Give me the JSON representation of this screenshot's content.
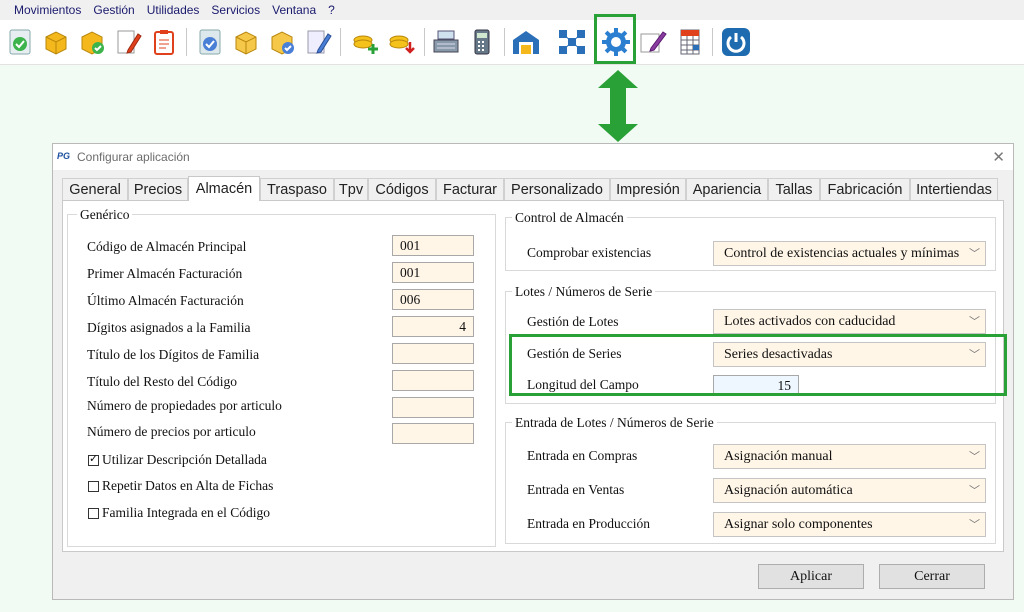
{
  "menu": [
    "Movimientos",
    "Gestión",
    "Utilidades",
    "Servicios",
    "Ventana",
    "?"
  ],
  "toolbar_icons": [
    "check-sphere-icon",
    "box-icon",
    "box-check-icon",
    "pencil-edit-icon",
    "clipboard-icon",
    "check-sphere-icon",
    "box-icon",
    "box-check-icon",
    "pencil-edit-icon",
    "coins-add-icon",
    "coins-download-icon",
    "cash-register-icon",
    "calculator-icon",
    "warehouse-icon",
    "network-icon",
    "gear-icon",
    "edit-pen-icon",
    "spreadsheet-icon",
    "power-icon"
  ],
  "colors": {
    "highlight": "#2aa137",
    "field_bg": "#fff6e8",
    "length_bg": "#eef6ff"
  },
  "dialog": {
    "logo": "PG",
    "title": "Configurar aplicación",
    "tabs": [
      "General",
      "Precios",
      "Almacén",
      "Traspaso",
      "Tpv",
      "Códigos",
      "Facturar",
      "Personalizado",
      "Impresión",
      "Apariencia",
      "Tallas",
      "Fabricación",
      "Intertiendas"
    ],
    "active_tab": "Almacén",
    "generico": {
      "title": "Genérico",
      "fields": [
        {
          "label": "Código de Almacén Principal",
          "value": "001"
        },
        {
          "label": "Primer Almacén Facturación",
          "value": "001"
        },
        {
          "label": "Último Almacén Facturación",
          "value": "006"
        },
        {
          "label": "Dígitos asignados a la Familia",
          "value": "4"
        },
        {
          "label": "Título de los Dígitos de Familia",
          "value": ""
        },
        {
          "label": "Título del Resto del Código",
          "value": ""
        },
        {
          "label": "Número de propiedades por articulo",
          "value": ""
        },
        {
          "label": "Número de precios por articulo",
          "value": ""
        }
      ],
      "checkboxes": [
        {
          "label": "Utilizar Descripción Detallada",
          "checked": true
        },
        {
          "label": "Repetir Datos en Alta de Fichas",
          "checked": false
        },
        {
          "label": "Familia Integrada en el Código",
          "checked": false
        }
      ]
    },
    "control": {
      "title": "Control de Almacén",
      "label": "Comprobar existencias",
      "value": "Control de existencias actuales y mínimas"
    },
    "lotes": {
      "title": "Lotes / Números de Serie",
      "gestion_lotes_label": "Gestión de Lotes",
      "gestion_lotes_value": "Lotes activados con caducidad",
      "gestion_series_label": "Gestión de Series",
      "gestion_series_value": "Series desactivadas",
      "longitud_label": "Longitud del Campo",
      "longitud_value": "15"
    },
    "entrada": {
      "title": "Entrada de Lotes / Números de Serie",
      "compras_label": "Entrada en Compras",
      "compras_value": "Asignación manual",
      "ventas_label": "Entrada en Ventas",
      "ventas_value": "Asignación automática",
      "produccion_label": "Entrada en Producción",
      "produccion_value": "Asignar solo componentes"
    },
    "buttons": {
      "apply": "Aplicar",
      "close": "Cerrar"
    }
  }
}
